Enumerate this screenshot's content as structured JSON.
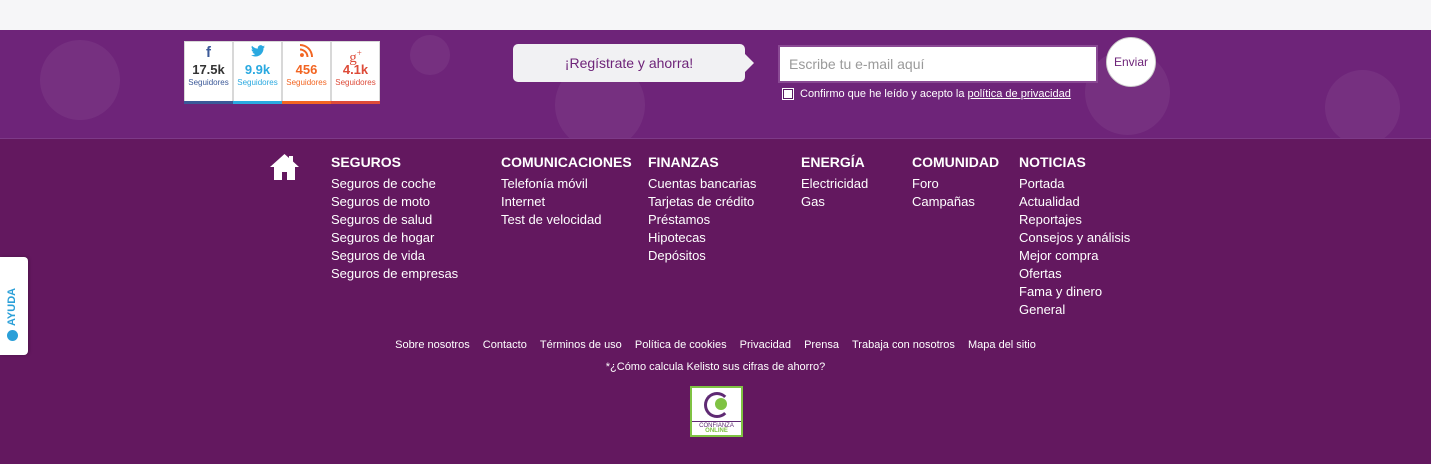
{
  "social": [
    {
      "glyph": "f",
      "count": "17.5k",
      "label": "Seguidores",
      "color": "#3b5998",
      "icon": "facebook-icon"
    },
    {
      "glyph": "🐦",
      "count": "9.9k",
      "label": "Seguidores",
      "color": "#2aa9e0",
      "icon": "twitter-icon"
    },
    {
      "glyph": "⟟",
      "count": "456",
      "label": "Seguidores",
      "color": "#f26522",
      "icon": "rss-icon"
    },
    {
      "glyph": "g+",
      "count": "4.1k",
      "label": "Seguidores",
      "color": "#dd4b39",
      "icon": "google-plus-icon"
    }
  ],
  "newsletter": {
    "cta": "¡Regístrate y ahorra!",
    "placeholder": "Escribe tu e-mail aquí",
    "send": "Enviar",
    "consent": "Confirmo que he leído y acepto la",
    "privacy_link": "política de privacidad"
  },
  "help": {
    "label": "AYUDA"
  },
  "columns": [
    {
      "title": "SEGUROS",
      "links": [
        "Seguros de coche",
        "Seguros de moto",
        "Seguros de salud",
        "Seguros de hogar",
        "Seguros de vida",
        "Seguros de empresas"
      ]
    },
    {
      "title": "COMUNICACIONES",
      "links": [
        "Telefonía móvil",
        "Internet",
        "Test de velocidad"
      ]
    },
    {
      "title": "FINANZAS",
      "links": [
        "Cuentas bancarias",
        "Tarjetas de crédito",
        "Préstamos",
        "Hipotecas",
        "Depósitos"
      ]
    },
    {
      "title": "ENERGÍA",
      "links": [
        "Electricidad",
        "Gas"
      ]
    },
    {
      "title": "COMUNIDAD",
      "links": [
        "Foro",
        "Campañas"
      ]
    },
    {
      "title": "NOTICIAS",
      "links": [
        "Portada",
        "Actualidad",
        "Reportajes",
        "Consejos y análisis",
        "Mejor compra",
        "Ofertas",
        "Fama y dinero",
        "General"
      ]
    }
  ],
  "bottom_links": [
    "Sobre nosotros",
    "Contacto",
    "Términos de uso",
    "Política de cookies",
    "Privacidad",
    "Prensa",
    "Trabaja con nosotros",
    "Mapa del sitio"
  ],
  "calc_note": "*¿Cómo calcula Kelisto sus cifras de ahorro?",
  "badge": {
    "line1": "CONFIANZA",
    "line2": "ONLINE"
  }
}
